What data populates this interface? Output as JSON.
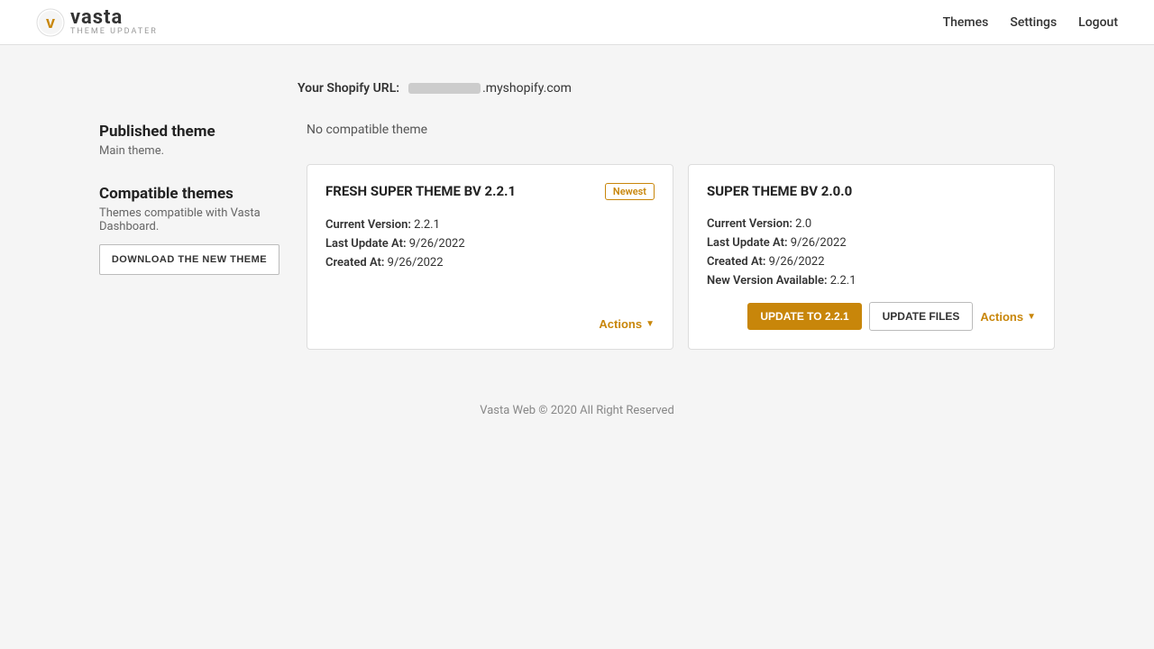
{
  "header": {
    "logo_vasta": "vasta",
    "logo_sub": "THEME UPDATER",
    "nav": {
      "themes": "Themes",
      "settings": "Settings",
      "logout": "Logout"
    }
  },
  "shopify_url": {
    "label": "Your Shopify URL:",
    "value": ".myshopify.com"
  },
  "sidebar": {
    "published_theme": {
      "title": "Published theme",
      "desc": "Main theme."
    },
    "compatible_themes": {
      "title": "Compatible themes",
      "desc": "Themes compatible with Vasta Dashboard.",
      "download_btn": "DOWNLOAD THE NEW THEME"
    }
  },
  "no_compatible": "No compatible theme",
  "themes": [
    {
      "title": "FRESH SUPER THEME BV 2.2.1",
      "badge": "Newest",
      "current_version_label": "Current Version:",
      "current_version": "2.2.1",
      "last_update_label": "Last Update At:",
      "last_update": "9/26/2022",
      "created_label": "Created At:",
      "created": "9/26/2022",
      "new_version_label": null,
      "new_version": null,
      "actions_label": "Actions"
    },
    {
      "title": "SUPER THEME BV 2.0.0",
      "badge": null,
      "current_version_label": "Current Version:",
      "current_version": "2.0",
      "last_update_label": "Last Update At:",
      "last_update": "9/26/2022",
      "created_label": "Created At:",
      "created": "9/26/2022",
      "new_version_label": "New Version Available:",
      "new_version": "2.2.1",
      "update_btn": "UPDATE TO 2.2.1",
      "update_files_btn": "UPDATE FILES",
      "actions_label": "Actions"
    }
  ],
  "footer": "Vasta Web © 2020 All Right Reserved"
}
